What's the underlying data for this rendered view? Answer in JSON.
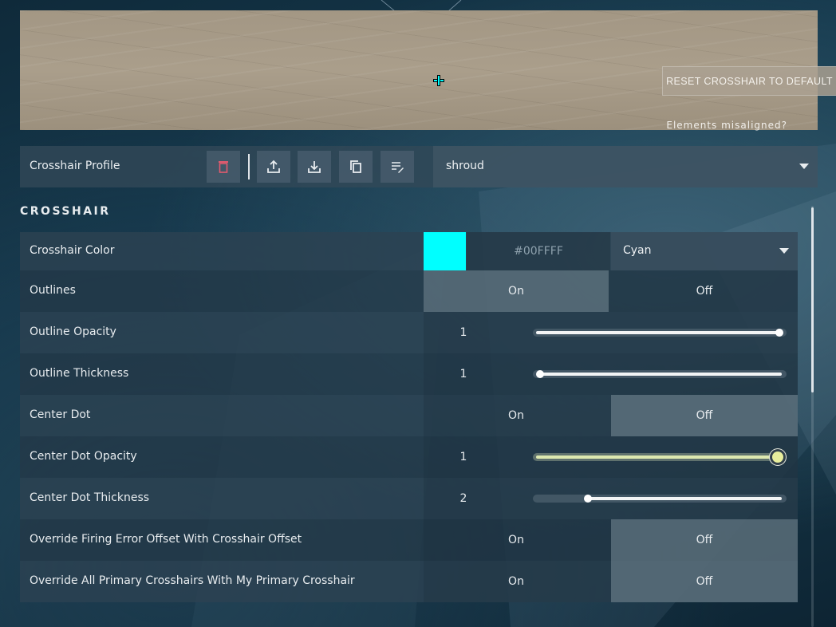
{
  "preview": {
    "reset_label": "RESET CROSSHAIR TO DEFAULT",
    "misaligned_label": "Elements misaligned?",
    "crosshair_color": "#00FFFF"
  },
  "profile": {
    "label": "Crosshair Profile",
    "selected": "shroud",
    "tools": [
      "trash-icon",
      "upload-icon",
      "download-icon",
      "copy-icon",
      "rename-icon"
    ]
  },
  "section": {
    "title": "CROSSHAIR"
  },
  "rows": {
    "color": {
      "label": "Crosshair Color",
      "hex": "#00FFFF",
      "swatch": "#00FFFF",
      "selected": "Cyan"
    },
    "outlines": {
      "label": "Outlines",
      "on": "On",
      "off": "Off",
      "active": "on"
    },
    "outline_opacity": {
      "label": "Outline Opacity",
      "value": "1",
      "fraction": 1.0
    },
    "outline_thickness": {
      "label": "Outline Thickness",
      "value": "1",
      "fraction": 0.0
    },
    "center_dot": {
      "label": "Center Dot",
      "on": "On",
      "off": "Off",
      "active": "off"
    },
    "center_dot_opacity": {
      "label": "Center Dot Opacity",
      "value": "1",
      "fraction": 1.0
    },
    "center_dot_thickness": {
      "label": "Center Dot Thickness",
      "value": "2",
      "fraction": 0.2
    },
    "override_firing": {
      "label": "Override Firing Error Offset With Crosshair Offset",
      "on": "On",
      "off": "Off",
      "active": "off"
    },
    "override_primary": {
      "label": "Override All Primary Crosshairs With My Primary Crosshair",
      "on": "On",
      "off": "Off",
      "active": "off"
    }
  },
  "colors": {
    "accent": "#00FFFF",
    "highlight": "#E8EE9C"
  }
}
